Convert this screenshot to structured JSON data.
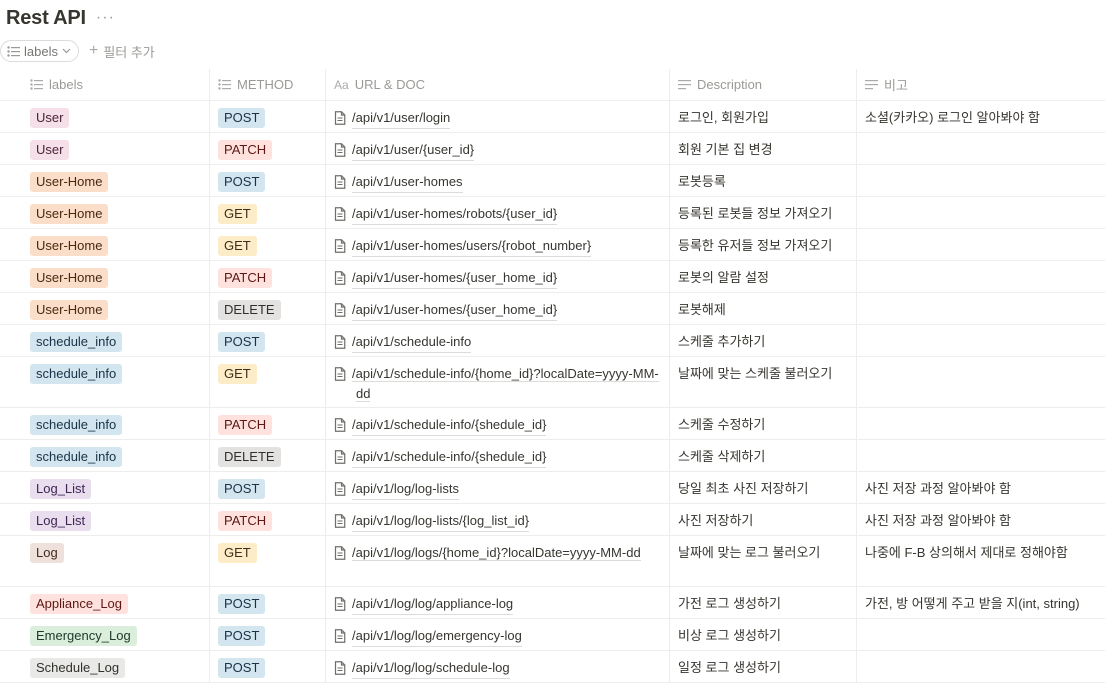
{
  "page": {
    "title": "Rest API",
    "more_glyph": "···"
  },
  "toolbar": {
    "view_label": "labels",
    "add_filter_label": "필터 추가"
  },
  "columns": {
    "labels": "labels",
    "method": "METHOD",
    "url": "URL & DOC",
    "url_icon": "Aa",
    "description": "Description",
    "note": "비고"
  },
  "rows": [
    {
      "label": "User",
      "label_style": "user",
      "method": "POST",
      "url": "/api/v1/user/login",
      "description": "로그인, 회원가입",
      "note": "소셜(카카오) 로그인 알아봐야 함"
    },
    {
      "label": "User",
      "label_style": "user",
      "method": "PATCH",
      "url": "/api/v1/user/{user_id}",
      "description": "회원 기본 집 변경",
      "note": ""
    },
    {
      "label": "User-Home",
      "label_style": "home",
      "method": "POST",
      "url": "/api/v1/user-homes",
      "description": "로봇등록",
      "note": ""
    },
    {
      "label": "User-Home",
      "label_style": "home",
      "method": "GET",
      "url": "/api/v1/user-homes/robots/{user_id}",
      "description": "등록된 로봇들 정보 가져오기",
      "note": ""
    },
    {
      "label": "User-Home",
      "label_style": "home",
      "method": "GET",
      "url": "/api/v1/user-homes/users/{robot_number}",
      "description": "등록한 유저들 정보 가져오기",
      "note": ""
    },
    {
      "label": "User-Home",
      "label_style": "home",
      "method": "PATCH",
      "url": "/api/v1/user-homes/{user_home_id}",
      "description": "로봇의 알람 설정",
      "note": ""
    },
    {
      "label": "User-Home",
      "label_style": "home",
      "method": "DELETE",
      "url": "/api/v1/user-homes/{user_home_id}",
      "description": "로봇해제",
      "note": ""
    },
    {
      "label": "schedule_info",
      "label_style": "sched",
      "method": "POST",
      "url": "/api/v1/schedule-info",
      "description": "스케줄 추가하기",
      "note": ""
    },
    {
      "label": "schedule_info",
      "label_style": "sched",
      "method": "GET",
      "url": "/api/v1/schedule-info/{home_id}?localDate=yyyy-MM-dd",
      "description": "날짜에 맞는 스케줄 불러오기",
      "note": "",
      "tall": true
    },
    {
      "label": "schedule_info",
      "label_style": "sched",
      "method": "PATCH",
      "url": "/api/v1/schedule-info/{shedule_id}",
      "description": "스케줄 수정하기",
      "note": ""
    },
    {
      "label": "schedule_info",
      "label_style": "sched",
      "method": "DELETE",
      "url": "/api/v1/schedule-info/{shedule_id}",
      "description": "스케줄 삭제하기",
      "note": ""
    },
    {
      "label": "Log_List",
      "label_style": "log",
      "method": "POST",
      "url": "/api/v1/log/log-lists",
      "description": "당일 최초 사진 저장하기",
      "note": "사진 저장 과정 알아봐야 함"
    },
    {
      "label": "Log_List",
      "label_style": "log",
      "method": "PATCH",
      "url": "/api/v1/log/log-lists/{log_list_id}",
      "description": "사진 저장하기",
      "note": "사진 저장 과정 알아봐야 함"
    },
    {
      "label": "Log",
      "label_style": "log2",
      "method": "GET",
      "url": "/api/v1/log/logs/{home_id}?localDate=yyyy-MM-dd",
      "description": "날짜에 맞는 로그 불러오기",
      "note": "나중에 F-B 상의해서 제대로 정해야함",
      "tall": true
    },
    {
      "label": "Appliance_Log",
      "label_style": "app",
      "method": "POST",
      "url": "/api/v1/log/log/appliance-log",
      "description": "가전 로그 생성하기",
      "note": "가전, 방 어떻게 주고 받을 지(int, string)"
    },
    {
      "label": "Emergency_Log",
      "label_style": "emg",
      "method": "POST",
      "url": "/api/v1/log/log/emergency-log",
      "description": "비상 로그 생성하기",
      "note": ""
    },
    {
      "label": "Schedule_Log",
      "label_style": "slog",
      "method": "POST",
      "url": "/api/v1/log/log/schedule-log",
      "description": "일정 로그 생성하기",
      "note": ""
    }
  ]
}
